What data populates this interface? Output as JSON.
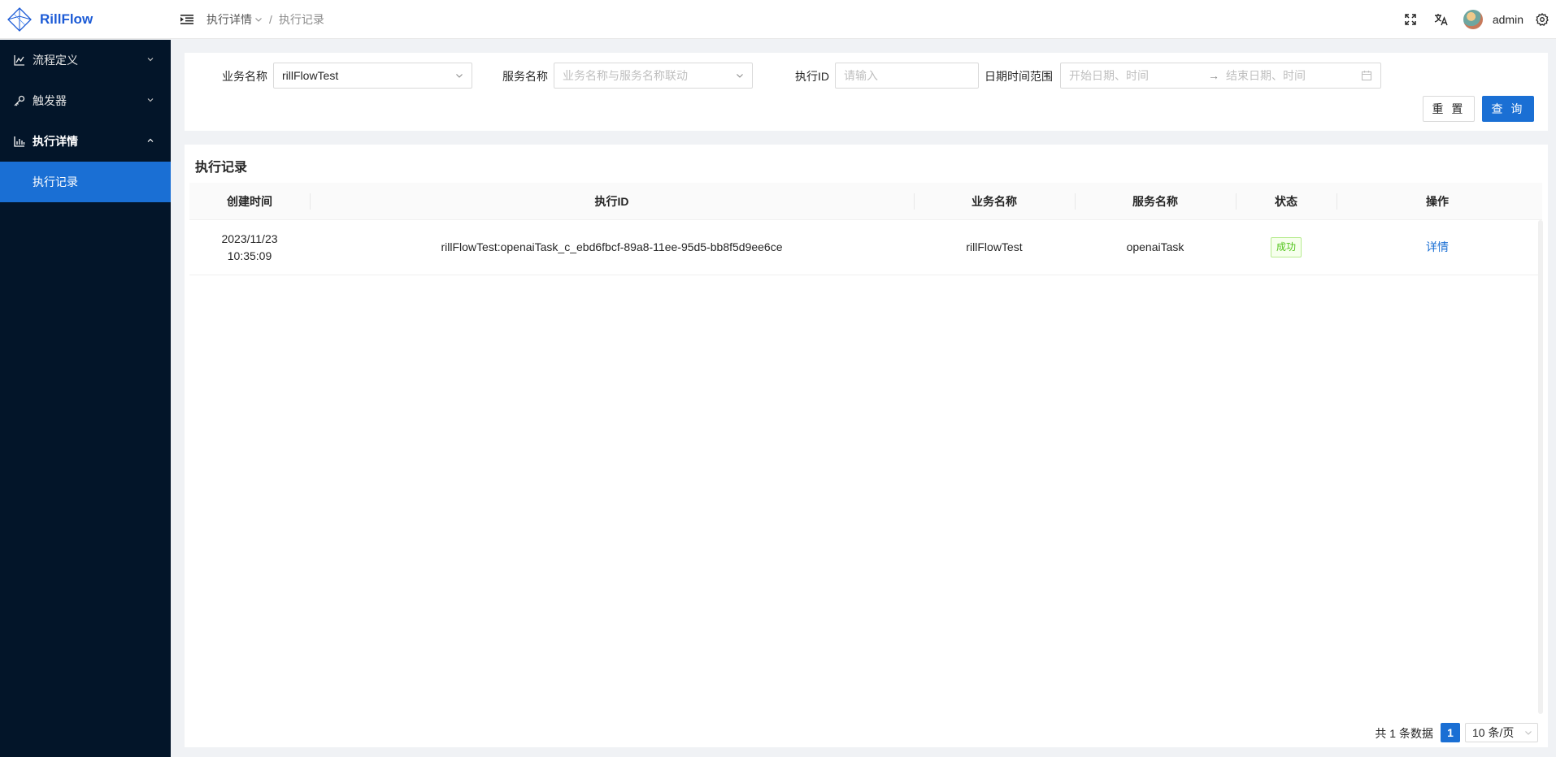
{
  "app": {
    "logo_text": "RillFlow"
  },
  "header": {
    "breadcrumb": {
      "parent": "执行详情",
      "current": "执行记录",
      "separator": "/"
    },
    "user": {
      "name": "admin"
    }
  },
  "sidebar": {
    "items": [
      {
        "label": "流程定义",
        "icon": "chart-line-icon",
        "state": "collapsed"
      },
      {
        "label": "触发器",
        "icon": "key-icon",
        "state": "collapsed"
      },
      {
        "label": "执行详情",
        "icon": "bar-chart-icon",
        "state": "expanded"
      }
    ],
    "sub_items": [
      {
        "label": "执行记录",
        "active": true
      }
    ]
  },
  "search": {
    "business_label": "业务名称",
    "business_value": "rillFlowTest",
    "service_label": "服务名称",
    "service_placeholder": "业务名称与服务名称联动",
    "exec_id_label": "执行ID",
    "exec_id_placeholder": "请输入",
    "date_range_label": "日期时间范围",
    "start_placeholder": "开始日期、时间",
    "end_placeholder": "结束日期、时间",
    "range_arrow": "→",
    "reset_label": "重 置",
    "query_label": "查 询"
  },
  "table": {
    "title": "执行记录",
    "columns": [
      "创建时间",
      "执行ID",
      "业务名称",
      "服务名称",
      "状态",
      "操作"
    ],
    "rows": [
      {
        "created_date": "2023/11/23",
        "created_time": "10:35:09",
        "exec_id": "rillFlowTest:openaiTask_c_ebd6fbcf-89a8-11ee-95d5-bb8f5d9ee6ce",
        "business": "rillFlowTest",
        "service": "openaiTask",
        "status": "成功",
        "action": "详情"
      }
    ]
  },
  "pagination": {
    "total_text": "共 1 条数据",
    "current_page": "1",
    "page_size": "10 条/页"
  },
  "colors": {
    "primary": "#1a6fd4",
    "sidebar_bg": "#031529",
    "success": "#52c41a"
  }
}
